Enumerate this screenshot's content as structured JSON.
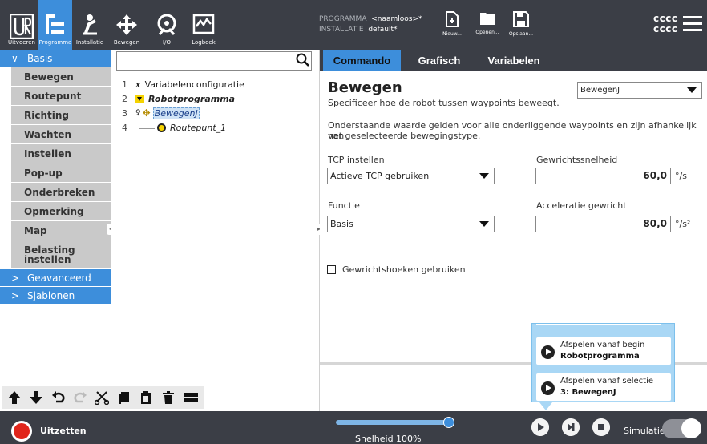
{
  "topbar": {
    "tabs": [
      {
        "label": "Uitvoeren"
      },
      {
        "label": "Programma"
      },
      {
        "label": "Installatie"
      },
      {
        "label": "Bewegen"
      },
      {
        "label": "I/O"
      },
      {
        "label": "Logboek"
      }
    ],
    "program_label": "PROGRAMMA",
    "program_value": "<naamloos>*",
    "installation_label": "INSTALLATIE",
    "installation_value": "default*",
    "file_buttons": [
      {
        "label": "Nieuw..."
      },
      {
        "label": "Openen..."
      },
      {
        "label": "Opslaan..."
      }
    ],
    "user_line1": "cccc",
    "user_line2": "cccc"
  },
  "leftnav": {
    "basis_label": "Basis",
    "items": [
      {
        "label": "Bewegen"
      },
      {
        "label": "Routepunt"
      },
      {
        "label": "Richting"
      },
      {
        "label": "Wachten"
      },
      {
        "label": "Instellen"
      },
      {
        "label": "Pop-up"
      },
      {
        "label": "Onderbreken"
      },
      {
        "label": "Opmerking"
      },
      {
        "label": "Map"
      },
      {
        "label": "Belasting instellen"
      }
    ],
    "advanced_label": "Geavanceerd",
    "templates_label": "Sjablonen"
  },
  "tree": {
    "search_placeholder": "",
    "rows": [
      {
        "line": "1",
        "label": "Variabelenconfiguratie"
      },
      {
        "line": "2",
        "label": "Robotprogramma"
      },
      {
        "line": "3",
        "label": "BewegenJ"
      },
      {
        "line": "4",
        "label": "Routepunt_1"
      }
    ]
  },
  "tabs": [
    {
      "label": "Commando"
    },
    {
      "label": "Grafisch"
    },
    {
      "label": "Variabelen"
    }
  ],
  "command": {
    "title": "Bewegen",
    "subtitle": "Specificeer hoe de robot tussen waypoints beweegt.",
    "move_type": "BewegenJ",
    "description_line1": "Onderstaande waarde gelden voor alle onderliggende waypoints en zijn afhankelijk van",
    "description_line2": "het geselecteerde bewegingstype.",
    "tcp_label": "TCP instellen",
    "tcp_value": "Actieve TCP gebruiken",
    "joint_speed_label": "Gewrichtssnelheid",
    "joint_speed_value": "60,0",
    "joint_speed_unit": "°/s",
    "feature_label": "Functie",
    "feature_value": "Basis",
    "joint_accel_label": "Acceleratie gewricht",
    "joint_accel_value": "80,0",
    "joint_accel_unit": "°/s²",
    "checkbox_label": "Gewrichtshoeken gebruiken"
  },
  "popup": {
    "btn1_line1": "Afspelen vanaf begin",
    "btn1_line2": "Robotprogramma",
    "btn2_line1": "Afspelen vanaf selectie",
    "btn2_line2": "3: BewegenJ"
  },
  "footer": {
    "power_label": "Uitzetten",
    "speed_label": "Snelheid 100%",
    "speed_value": 1.0,
    "sim_label": "Simulatie"
  }
}
